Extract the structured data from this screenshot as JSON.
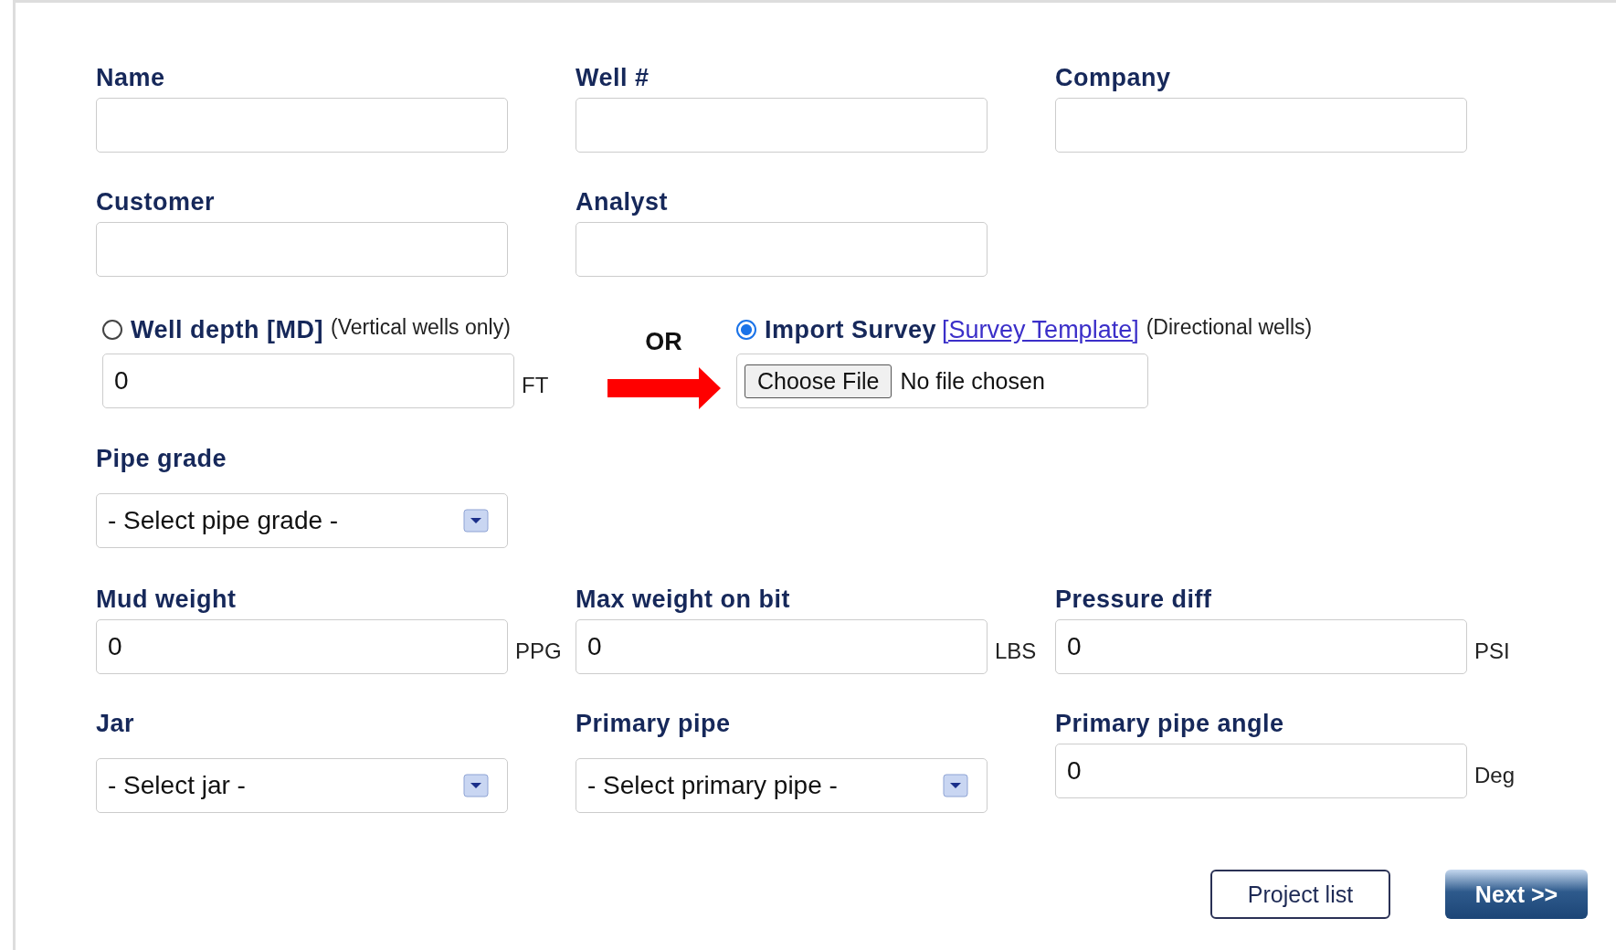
{
  "rows": [
    [
      {
        "kind": "text",
        "label": "Name"
      },
      {
        "kind": "text",
        "label": "Well #"
      },
      {
        "kind": "text",
        "label": "Company"
      }
    ],
    [
      {
        "kind": "text",
        "label": "Customer"
      },
      {
        "kind": "text",
        "label": "Analyst"
      }
    ]
  ],
  "depth_source": {
    "separator": "OR",
    "options": [
      {
        "kind": "depth",
        "label": "Well depth [MD]",
        "note": "(Vertical wells only)",
        "selected": false,
        "value": "0",
        "unit": "FT"
      },
      {
        "kind": "survey",
        "label": "Import Survey",
        "link": "[Survey Template]",
        "note": "(Directional wells)",
        "selected": true,
        "button": "Choose File",
        "file_status": "No file chosen"
      }
    ]
  },
  "rows_after": [
    [
      {
        "kind": "select",
        "label": "Pipe grade",
        "value": "- Select pipe grade -"
      }
    ],
    [
      {
        "kind": "text",
        "label": "Mud weight",
        "value": "0",
        "unit": "PPG"
      },
      {
        "kind": "text",
        "label": "Max weight on bit",
        "value": "0",
        "unit": "LBS"
      },
      {
        "kind": "text",
        "label": "Pressure diff",
        "value": "0",
        "unit": "PSI"
      }
    ],
    [
      {
        "kind": "select",
        "label": "Jar",
        "value": "- Select jar -"
      },
      {
        "kind": "select",
        "label": "Primary pipe",
        "value": "- Select primary pipe -"
      },
      {
        "kind": "text",
        "label": "Primary pipe angle",
        "value": "0",
        "unit": "Deg"
      }
    ]
  ],
  "buttons": [
    {
      "kind": "secondary",
      "label": "Project list"
    },
    {
      "kind": "primary",
      "label": "Next >>"
    }
  ]
}
